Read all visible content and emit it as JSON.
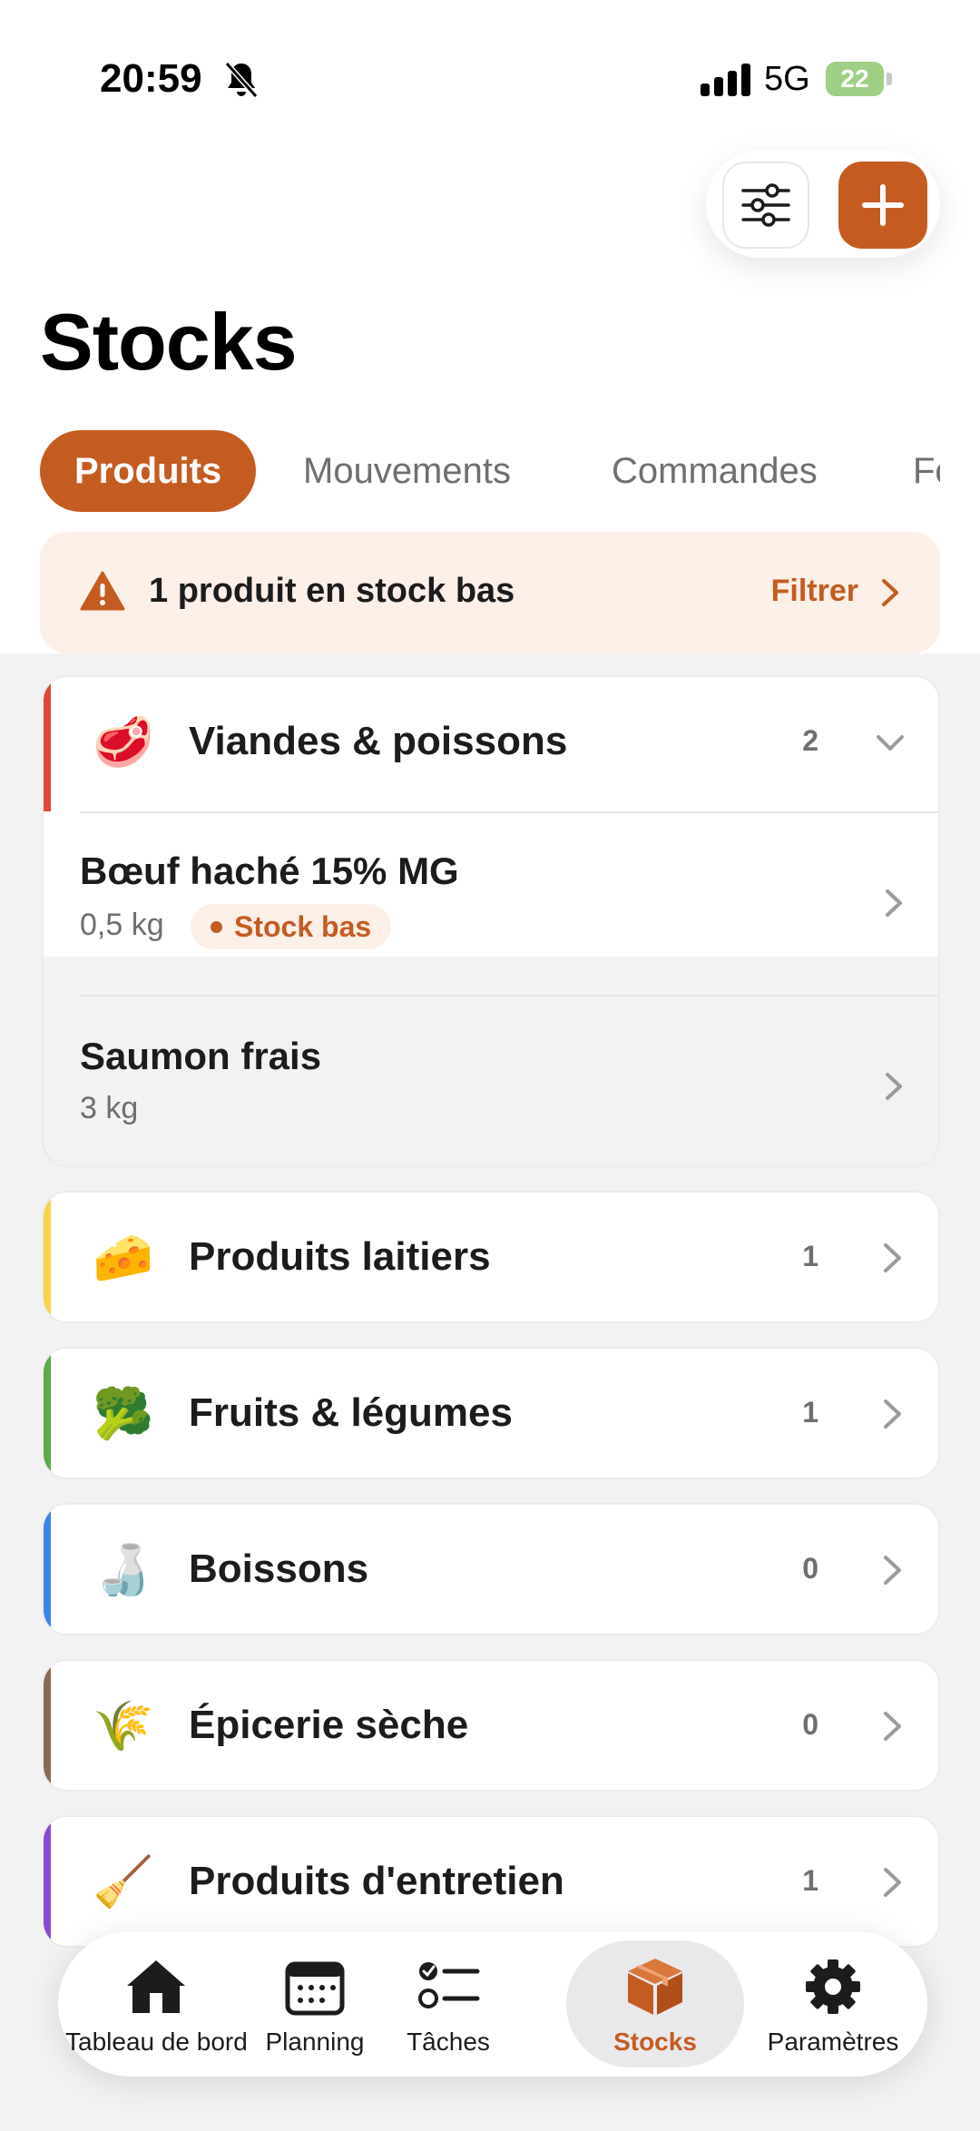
{
  "status_bar": {
    "time": "20:59",
    "network": "5G",
    "battery": "22"
  },
  "header": {
    "title": "Stocks",
    "filter_icon": "sliders-icon",
    "add_icon": "plus-icon"
  },
  "tabs": [
    {
      "label": "Produits",
      "active": true
    },
    {
      "label": "Mouvements",
      "active": false
    },
    {
      "label": "Commandes",
      "active": false
    },
    {
      "label": "Fo",
      "active": false
    }
  ],
  "alert": {
    "icon": "warning-icon",
    "text": "1 produit en stock bas",
    "action": "Filtrer"
  },
  "categories": [
    {
      "emoji": "🥩",
      "name": "Viandes & poissons",
      "count": "2",
      "accent": "#e0463a",
      "expanded": true,
      "products": [
        {
          "name": "Bœuf haché 15% MG",
          "qty": "0,5 kg",
          "badge": "Stock bas"
        },
        {
          "name": "Saumon frais",
          "qty": "3 kg",
          "badge": ""
        }
      ]
    },
    {
      "emoji": "🧀",
      "name": "Produits laitiers",
      "count": "1",
      "accent": "#f5d547",
      "expanded": false
    },
    {
      "emoji": "🥦",
      "name": "Fruits & légumes",
      "count": "1",
      "accent": "#5fa84a",
      "expanded": false
    },
    {
      "emoji": "🍶",
      "name": "Boissons",
      "count": "0",
      "accent": "#3c83e6",
      "expanded": false
    },
    {
      "emoji": "🌾",
      "name": "Épicerie sèche",
      "count": "0",
      "accent": "#8a6a55",
      "expanded": false
    },
    {
      "emoji": "🧹",
      "name": "Produits d'entretien",
      "count": "1",
      "accent": "#8a4ad0",
      "expanded": false
    }
  ],
  "bottom_nav": [
    {
      "label": "Tableau de bord",
      "icon": "home-icon",
      "active": false
    },
    {
      "label": "Planning",
      "icon": "calendar-icon",
      "active": false
    },
    {
      "label": "Tâches",
      "icon": "checklist-icon",
      "active": false
    },
    {
      "label": "Stocks",
      "icon": "box-icon",
      "active": true
    },
    {
      "label": "Paramètres",
      "icon": "gear-icon",
      "active": false
    }
  ],
  "colors": {
    "accent": "#c45c22",
    "alert_bg": "#fcefe7",
    "background": "#f2f2f3"
  }
}
